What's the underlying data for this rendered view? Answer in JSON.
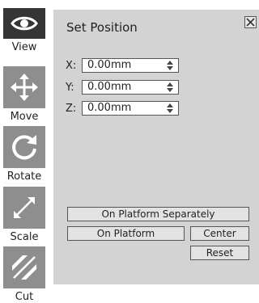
{
  "toolbar": {
    "items": [
      {
        "label": "View",
        "icon": "eye-icon",
        "active": true
      },
      {
        "label": "Move",
        "icon": "move-icon",
        "active": false
      },
      {
        "label": "Rotate",
        "icon": "rotate-icon",
        "active": false
      },
      {
        "label": "Scale",
        "icon": "scale-icon",
        "active": false
      },
      {
        "label": "Cut",
        "icon": "cut-icon",
        "active": false
      }
    ]
  },
  "panel": {
    "title": "Set Position",
    "fields": [
      {
        "axis": "X:",
        "value": "0.00mm"
      },
      {
        "axis": "Y:",
        "value": "0.00mm"
      },
      {
        "axis": "Z:",
        "value": "0.00mm"
      }
    ],
    "buttons": {
      "on_platform_separately": "On Platform Separately",
      "on_platform": "On Platform",
      "center": "Center",
      "reset": "Reset"
    }
  },
  "colors": {
    "toolbar_active": "#353535",
    "toolbar_inactive": "#8e8e8e",
    "panel_bg": "#d3d3d3",
    "button_bg": "#e3e3e3"
  }
}
